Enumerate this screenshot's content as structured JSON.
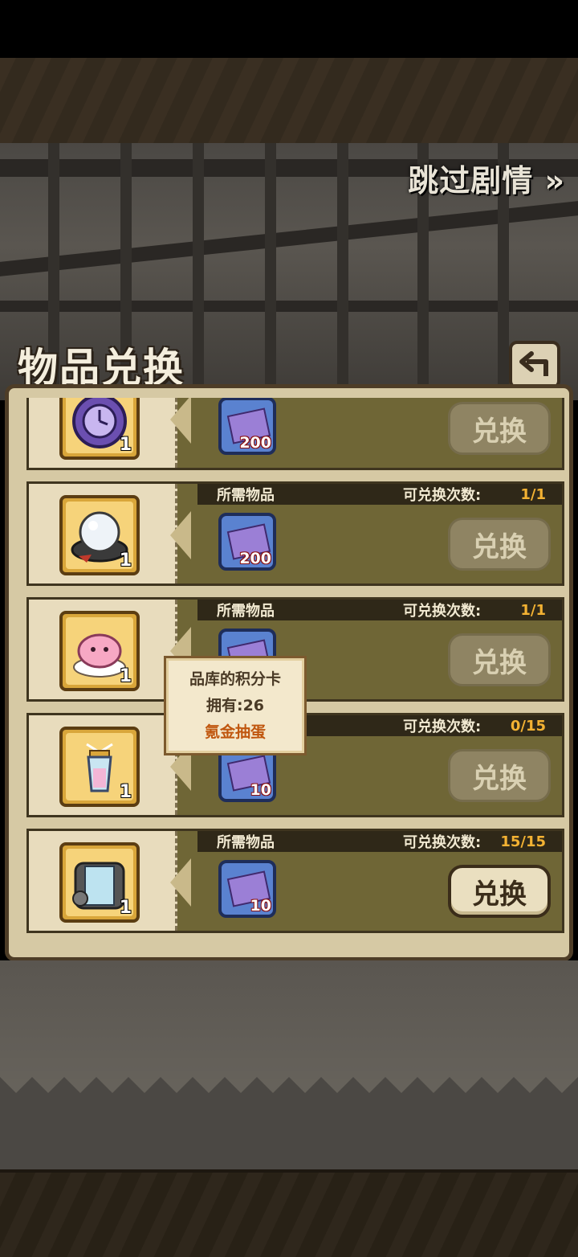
{
  "skip_label": "跳过剧情 »",
  "title": "物品兑换",
  "header_required": "所需物品",
  "header_limit": "可兑换次数:",
  "redeem_label": "兑换",
  "rows": [
    {
      "icon": "pocket-watch-icon",
      "item_count": "1",
      "cost": "200",
      "limit": "",
      "enabled": false
    },
    {
      "icon": "crystal-orb-icon",
      "item_count": "1",
      "cost": "200",
      "limit": "1/1",
      "enabled": false
    },
    {
      "icon": "pink-creature-icon",
      "item_count": "1",
      "cost": "",
      "limit": "1/1",
      "enabled": false
    },
    {
      "icon": "potion-vial-icon",
      "item_count": "1",
      "cost": "10",
      "limit": "0/15",
      "enabled": false
    },
    {
      "icon": "card-pack-icon",
      "item_count": "1",
      "cost": "10",
      "limit": "15/15",
      "enabled": true
    }
  ],
  "tooltip": {
    "name": "品库的积分卡",
    "owned": "拥有:26",
    "source": "氪金抽蛋"
  },
  "colors": {
    "limit_value": "#f3b233",
    "tooltip_source": "#c0560e"
  }
}
